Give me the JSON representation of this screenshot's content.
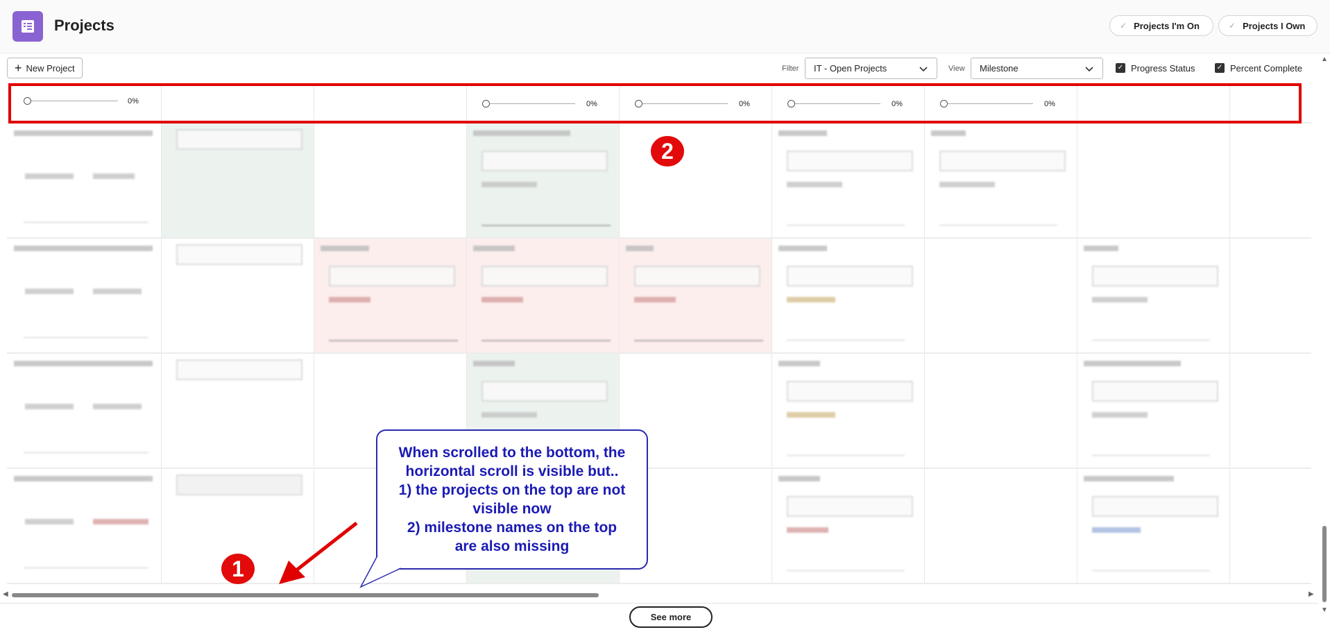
{
  "header": {
    "title": "Projects",
    "app_icon": "project-list-icon",
    "pill_mine_label": "Projects I'm On",
    "pill_own_label": "Projects I Own",
    "accent_color": "#8a63d2"
  },
  "toolbar": {
    "new_project_label": "New Project",
    "filter_label": "Filter",
    "filter_value": "IT - Open Projects",
    "view_label": "View",
    "view_value": "Milestone",
    "progress_status_label": "Progress Status",
    "progress_status_checked": true,
    "percent_complete_label": "Percent Complete",
    "percent_complete_checked": true
  },
  "top_row": {
    "sliders": [
      {
        "column": 1,
        "value": "0%"
      },
      {
        "column": 4,
        "value": "0%"
      },
      {
        "column": 5,
        "value": "0%"
      },
      {
        "column": 6,
        "value": "0%"
      },
      {
        "column": 7,
        "value": "0%"
      }
    ]
  },
  "annotations": {
    "marker_1": "1",
    "marker_2": "2",
    "callout_text": "When scrolled to the bottom, the horizontal scroll is visible but.. 1) the projects on the top are not visible now 2) milestone names on the top are also missing",
    "callout_lines": [
      "When scrolled to the bottom, the",
      "horizontal scroll is visible but..",
      "1) the projects on the top are not",
      "visible now",
      "2) milestone names on the top",
      "are also missing"
    ],
    "highlight_color": "#e00000",
    "callout_color": "#1a1ab4"
  },
  "footer": {
    "see_more_label": "See more"
  }
}
